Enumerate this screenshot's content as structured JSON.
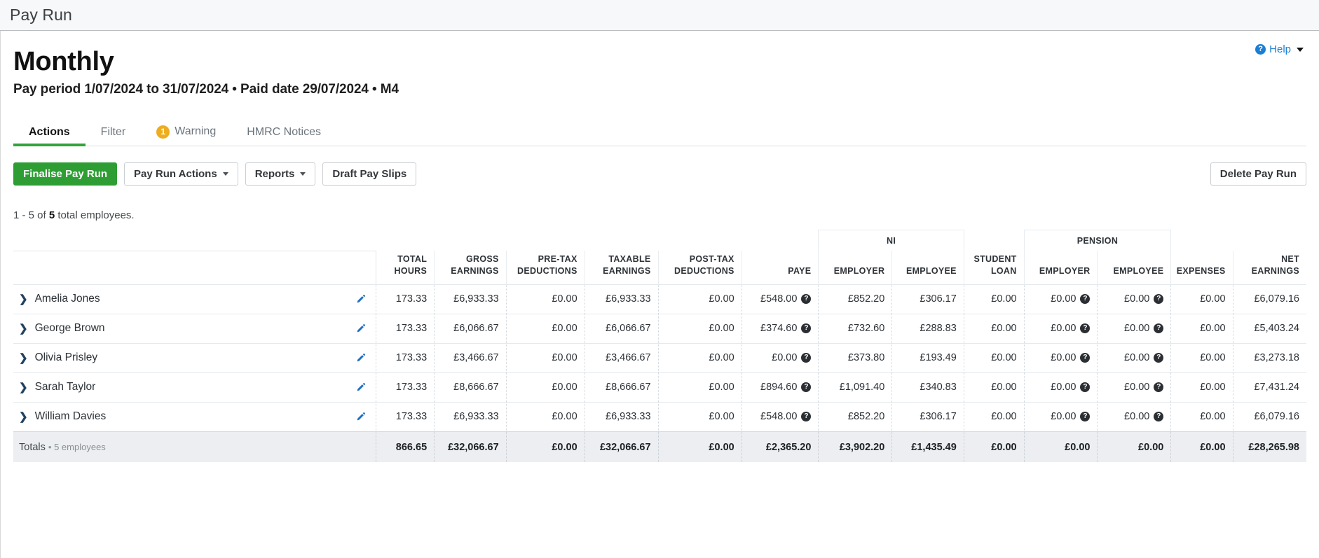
{
  "topbar": {
    "title": "Pay Run"
  },
  "help": {
    "label": "Help",
    "icon": "question-circle-icon"
  },
  "header": {
    "title": "Monthly",
    "subtitle": "Pay period 1/07/2024 to 31/07/2024 • Paid date 29/07/2024 • M4"
  },
  "tabs": [
    {
      "label": "Actions",
      "active": true,
      "badge": null
    },
    {
      "label": "Filter",
      "active": false,
      "badge": null
    },
    {
      "label": "Warning",
      "active": false,
      "badge": "1"
    },
    {
      "label": "HMRC Notices",
      "active": false,
      "badge": null
    }
  ],
  "toolbar": {
    "finalise_label": "Finalise Pay Run",
    "pay_run_actions_label": "Pay Run Actions",
    "reports_label": "Reports",
    "draft_pay_slips_label": "Draft Pay Slips",
    "delete_label": "Delete Pay Run"
  },
  "count": {
    "prefix": "1 - 5 of ",
    "total": "5",
    "suffix": " total employees."
  },
  "table": {
    "group_headers": [
      {
        "label": "NI",
        "span": 2
      },
      {
        "label": "PENSION",
        "span": 2
      }
    ],
    "columns": [
      "TOTAL HOURS",
      "GROSS EARNINGS",
      "PRE-TAX DEDUCTIONS",
      "TAXABLE EARNINGS",
      "POST-TAX DEDUCTIONS",
      "PAYE",
      "EMPLOYER",
      "EMPLOYEE",
      "STUDENT LOAN",
      "EMPLOYER",
      "EMPLOYEE",
      "EXPENSES",
      "NET EARNINGS"
    ],
    "rows": [
      {
        "name": "Amelia Jones",
        "total_hours": "173.33",
        "gross_earnings": "£6,933.33",
        "pre_tax_deductions": "£0.00",
        "taxable_earnings": "£6,933.33",
        "post_tax_deductions": "£0.00",
        "paye": "£548.00",
        "ni_employer": "£852.20",
        "ni_employee": "£306.17",
        "student_loan": "£0.00",
        "pension_employer": "£0.00",
        "pension_employee": "£0.00",
        "expenses": "£0.00",
        "net_earnings": "£6,079.16"
      },
      {
        "name": "George Brown",
        "total_hours": "173.33",
        "gross_earnings": "£6,066.67",
        "pre_tax_deductions": "£0.00",
        "taxable_earnings": "£6,066.67",
        "post_tax_deductions": "£0.00",
        "paye": "£374.60",
        "ni_employer": "£732.60",
        "ni_employee": "£288.83",
        "student_loan": "£0.00",
        "pension_employer": "£0.00",
        "pension_employee": "£0.00",
        "expenses": "£0.00",
        "net_earnings": "£5,403.24"
      },
      {
        "name": "Olivia Prisley",
        "total_hours": "173.33",
        "gross_earnings": "£3,466.67",
        "pre_tax_deductions": "£0.00",
        "taxable_earnings": "£3,466.67",
        "post_tax_deductions": "£0.00",
        "paye": "£0.00",
        "ni_employer": "£373.80",
        "ni_employee": "£193.49",
        "student_loan": "£0.00",
        "pension_employer": "£0.00",
        "pension_employee": "£0.00",
        "expenses": "£0.00",
        "net_earnings": "£3,273.18"
      },
      {
        "name": "Sarah Taylor",
        "total_hours": "173.33",
        "gross_earnings": "£8,666.67",
        "pre_tax_deductions": "£0.00",
        "taxable_earnings": "£8,666.67",
        "post_tax_deductions": "£0.00",
        "paye": "£894.60",
        "ni_employer": "£1,091.40",
        "ni_employee": "£340.83",
        "student_loan": "£0.00",
        "pension_employer": "£0.00",
        "pension_employee": "£0.00",
        "expenses": "£0.00",
        "net_earnings": "£7,431.24"
      },
      {
        "name": "William Davies",
        "total_hours": "173.33",
        "gross_earnings": "£6,933.33",
        "pre_tax_deductions": "£0.00",
        "taxable_earnings": "£6,933.33",
        "post_tax_deductions": "£0.00",
        "paye": "£548.00",
        "ni_employer": "£852.20",
        "ni_employee": "£306.17",
        "student_loan": "£0.00",
        "pension_employer": "£0.00",
        "pension_employee": "£0.00",
        "expenses": "£0.00",
        "net_earnings": "£6,079.16"
      }
    ],
    "totals": {
      "label": "Totals",
      "sub_label": "• 5 employees",
      "total_hours": "866.65",
      "gross_earnings": "£32,066.67",
      "pre_tax_deductions": "£0.00",
      "taxable_earnings": "£32,066.67",
      "post_tax_deductions": "£0.00",
      "paye": "£2,365.20",
      "ni_employer": "£3,902.20",
      "ni_employee": "£1,435.49",
      "student_loan": "£0.00",
      "pension_employer": "£0.00",
      "pension_employee": "£0.00",
      "expenses": "£0.00",
      "net_earnings": "£28,265.98"
    }
  },
  "colors": {
    "primary_green": "#2e9e34",
    "tab_underline": "#34a23a",
    "warning_badge": "#edad1e",
    "link_blue": "#1a7fd4",
    "pencil_blue": "#1f6fc4",
    "totals_bg": "#eceef1"
  }
}
